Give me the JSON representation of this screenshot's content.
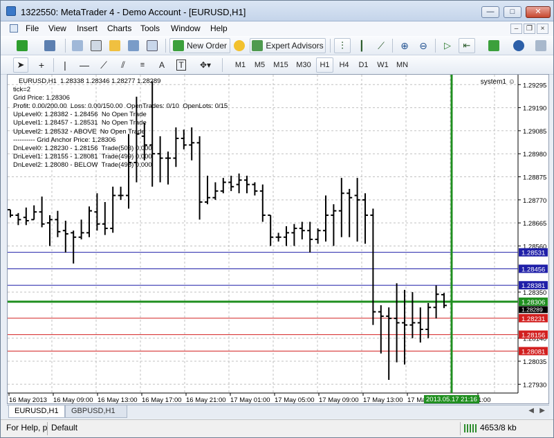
{
  "window": {
    "title": "1322550: MetaTrader 4 - Demo Account - [EURUSD,H1]",
    "min_label": "—",
    "max_label": "□",
    "close_label": "✕"
  },
  "menu": {
    "items": [
      "File",
      "View",
      "Insert",
      "Charts",
      "Tools",
      "Window",
      "Help"
    ],
    "mdi_min": "–",
    "mdi_restore": "❐",
    "mdi_close": "×"
  },
  "toolbar": {
    "new_order_label": "New Order",
    "expert_advisors_label": "Expert Advisors",
    "timeframes": [
      "M1",
      "M5",
      "M15",
      "M30",
      "H1",
      "H4",
      "D1",
      "W1",
      "MN"
    ],
    "active_timeframe": "H1",
    "text_tool_label": "A"
  },
  "chart": {
    "info_lines": [
      "EURUSD,H1  1.28338 1.28346 1.28277 1.28289",
      "tick=2",
      "Grid Price: 1.28306",
      "Profit: 0.00/200.00  Loss: 0.00/150.00  OpenTrades: 0/10  OpenLots: 0/15",
      "UpLevel0: 1.28382 - 1.28456  No Open Trade",
      "UpLevel1: 1.28457 - 1.28531  No Open Trade",
      "UpLevel2: 1.28532 - ABOVE  No Open Trade",
      "---------- Grid Anchor Price: 1.28306",
      "DnLevel0: 1.28230 - 1.28156  Trade(503) 0.000",
      "DnLevel1: 1.28155 - 1.28081  Trade(499) 0.000",
      "DnLevel2: 1.28080 - BELOW  Trade(498) 0.000"
    ],
    "expert_label": "system1",
    "price_labels": [
      "1.29295",
      "1.29190",
      "1.29085",
      "1.28980",
      "1.28875",
      "1.28770",
      "1.28665",
      "1.28560",
      "1.28350",
      "1.28140",
      "1.28035",
      "1.27930"
    ],
    "level_labels": [
      {
        "text": "1.28531",
        "price": 1.28531,
        "color": "#1f1fa8"
      },
      {
        "text": "1.28456",
        "price": 1.28456,
        "color": "#1f1fa8"
      },
      {
        "text": "1.28381",
        "price": 1.28381,
        "color": "#1f1fa8"
      },
      {
        "text": "1.28306",
        "price": 1.28306,
        "color": "#1f8f1f"
      },
      {
        "text": "1.28231",
        "price": 1.28231,
        "color": "#d21f1f"
      },
      {
        "text": "1.28156",
        "price": 1.28156,
        "color": "#d21f1f"
      },
      {
        "text": "1.28081",
        "price": 1.28081,
        "color": "#d21f1f"
      }
    ],
    "current_price_label": "1.28289",
    "time_labels": [
      "16 May 2013",
      "16 May 09:00",
      "16 May 13:00",
      "16 May 17:00",
      "16 May 21:00",
      "17 May 01:00",
      "17 May 05:00",
      "17 May 09:00",
      "17 May 13:00",
      "17 Ma",
      "1:00"
    ],
    "crosshair_time_label": "2013.05.17 21:16",
    "y_range": [
      1.2789,
      1.2934
    ],
    "bars": [
      [
        1.28725,
        1.28725,
        1.2869,
        1.287
      ],
      [
        1.287,
        1.2871,
        1.28655,
        1.2868
      ],
      [
        1.2869,
        1.28735,
        1.28655,
        1.28675
      ],
      [
        1.2868,
        1.28745,
        1.2868,
        1.28715
      ],
      [
        1.28715,
        1.28785,
        1.28645,
        1.2866
      ],
      [
        1.28665,
        1.287,
        1.2856,
        1.2868
      ],
      [
        1.2868,
        1.2872,
        1.286,
        1.28625
      ],
      [
        1.2863,
        1.28675,
        1.2853,
        1.28615
      ],
      [
        1.2862,
        1.2863,
        1.2848,
        1.286
      ],
      [
        1.286,
        1.2868,
        1.2859,
        1.2862
      ],
      [
        1.2862,
        1.2874,
        1.286,
        1.2872
      ],
      [
        1.28715,
        1.288,
        1.2863,
        1.2866
      ],
      [
        1.2866,
        1.2876,
        1.2861,
        1.2864
      ],
      [
        1.2864,
        1.2883,
        1.2862,
        1.2879
      ],
      [
        1.2879,
        1.2883,
        1.2877,
        1.2879
      ],
      [
        1.2879,
        1.2907,
        1.2873,
        1.2894
      ],
      [
        1.2894,
        1.2924,
        1.2885,
        1.2907
      ],
      [
        1.2906,
        1.2912,
        1.2895,
        1.2902
      ],
      [
        1.2902,
        1.2931,
        1.2883,
        1.2898
      ],
      [
        1.2898,
        1.2906,
        1.2885,
        1.2896
      ],
      [
        1.2896,
        1.2899,
        1.2884,
        1.2896
      ],
      [
        1.2896,
        1.291,
        1.2892,
        1.2905
      ],
      [
        1.2905,
        1.2909,
        1.29,
        1.2902
      ],
      [
        1.2902,
        1.291,
        1.2895,
        1.2903
      ],
      [
        1.2903,
        1.2906,
        1.2868,
        1.2876
      ],
      [
        1.2876,
        1.2888,
        1.2875,
        1.2878
      ],
      [
        1.2878,
        1.2885,
        1.2877,
        1.2881
      ],
      [
        1.2881,
        1.2887,
        1.288,
        1.2885
      ],
      [
        1.2885,
        1.2888,
        1.2881,
        1.2883
      ],
      [
        1.2884,
        1.2889,
        1.288,
        1.2886
      ],
      [
        1.2886,
        1.2888,
        1.288,
        1.2884
      ],
      [
        1.2884,
        1.2885,
        1.2879,
        1.2881
      ],
      [
        1.2881,
        1.2884,
        1.2867,
        1.287
      ],
      [
        1.287,
        1.287,
        1.2856,
        1.286
      ],
      [
        1.286,
        1.2862,
        1.2858,
        1.286
      ],
      [
        1.286,
        1.2865,
        1.2856,
        1.2862
      ],
      [
        1.2862,
        1.2866,
        1.2856,
        1.2864
      ],
      [
        1.2864,
        1.2867,
        1.2859,
        1.2863
      ],
      [
        1.2863,
        1.2867,
        1.2853,
        1.2859
      ],
      [
        1.2859,
        1.2864,
        1.2857,
        1.2863
      ],
      [
        1.2863,
        1.2879,
        1.2858,
        1.287
      ],
      [
        1.287,
        1.2875,
        1.2856,
        1.2872
      ],
      [
        1.2872,
        1.2887,
        1.286,
        1.288
      ],
      [
        1.288,
        1.2882,
        1.286,
        1.2878
      ],
      [
        1.2879,
        1.2887,
        1.2858,
        1.2877
      ],
      [
        1.2877,
        1.288,
        1.2857,
        1.287
      ],
      [
        1.287,
        1.2873,
        1.282,
        1.2826
      ],
      [
        1.2826,
        1.2829,
        1.2807,
        1.2824
      ],
      [
        1.2824,
        1.2828,
        1.2795,
        1.2823
      ],
      [
        1.2823,
        1.2839,
        1.2803,
        1.2821
      ],
      [
        1.2821,
        1.2836,
        1.2802,
        1.282
      ],
      [
        1.282,
        1.2835,
        1.2814,
        1.2821
      ],
      [
        1.2821,
        1.2828,
        1.2812,
        1.2818
      ],
      [
        1.2818,
        1.283,
        1.2814,
        1.2828
      ],
      [
        1.2828,
        1.2838,
        1.2823,
        1.2834
      ],
      [
        1.28338,
        1.28346,
        1.28277,
        1.28289
      ]
    ]
  },
  "tabs": [
    "EURUSD,H1",
    "GBPUSD,H1"
  ],
  "status": {
    "help_text": "For Help, p",
    "profile": "Default",
    "traffic": "4653/8 kb"
  }
}
